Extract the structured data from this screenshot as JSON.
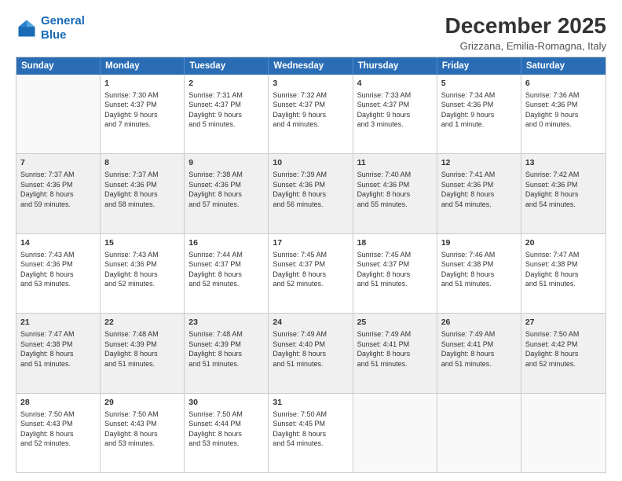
{
  "logo": {
    "line1": "General",
    "line2": "Blue"
  },
  "title": "December 2025",
  "subtitle": "Grizzana, Emilia-Romagna, Italy",
  "weekdays": [
    "Sunday",
    "Monday",
    "Tuesday",
    "Wednesday",
    "Thursday",
    "Friday",
    "Saturday"
  ],
  "rows": [
    [
      {
        "day": "",
        "text": ""
      },
      {
        "day": "1",
        "text": "Sunrise: 7:30 AM\nSunset: 4:37 PM\nDaylight: 9 hours\nand 7 minutes."
      },
      {
        "day": "2",
        "text": "Sunrise: 7:31 AM\nSunset: 4:37 PM\nDaylight: 9 hours\nand 5 minutes."
      },
      {
        "day": "3",
        "text": "Sunrise: 7:32 AM\nSunset: 4:37 PM\nDaylight: 9 hours\nand 4 minutes."
      },
      {
        "day": "4",
        "text": "Sunrise: 7:33 AM\nSunset: 4:37 PM\nDaylight: 9 hours\nand 3 minutes."
      },
      {
        "day": "5",
        "text": "Sunrise: 7:34 AM\nSunset: 4:36 PM\nDaylight: 9 hours\nand 1 minute."
      },
      {
        "day": "6",
        "text": "Sunrise: 7:36 AM\nSunset: 4:36 PM\nDaylight: 9 hours\nand 0 minutes."
      }
    ],
    [
      {
        "day": "7",
        "text": "Sunrise: 7:37 AM\nSunset: 4:36 PM\nDaylight: 8 hours\nand 59 minutes."
      },
      {
        "day": "8",
        "text": "Sunrise: 7:37 AM\nSunset: 4:36 PM\nDaylight: 8 hours\nand 58 minutes."
      },
      {
        "day": "9",
        "text": "Sunrise: 7:38 AM\nSunset: 4:36 PM\nDaylight: 8 hours\nand 57 minutes."
      },
      {
        "day": "10",
        "text": "Sunrise: 7:39 AM\nSunset: 4:36 PM\nDaylight: 8 hours\nand 56 minutes."
      },
      {
        "day": "11",
        "text": "Sunrise: 7:40 AM\nSunset: 4:36 PM\nDaylight: 8 hours\nand 55 minutes."
      },
      {
        "day": "12",
        "text": "Sunrise: 7:41 AM\nSunset: 4:36 PM\nDaylight: 8 hours\nand 54 minutes."
      },
      {
        "day": "13",
        "text": "Sunrise: 7:42 AM\nSunset: 4:36 PM\nDaylight: 8 hours\nand 54 minutes."
      }
    ],
    [
      {
        "day": "14",
        "text": "Sunrise: 7:43 AM\nSunset: 4:36 PM\nDaylight: 8 hours\nand 53 minutes."
      },
      {
        "day": "15",
        "text": "Sunrise: 7:43 AM\nSunset: 4:36 PM\nDaylight: 8 hours\nand 52 minutes."
      },
      {
        "day": "16",
        "text": "Sunrise: 7:44 AM\nSunset: 4:37 PM\nDaylight: 8 hours\nand 52 minutes."
      },
      {
        "day": "17",
        "text": "Sunrise: 7:45 AM\nSunset: 4:37 PM\nDaylight: 8 hours\nand 52 minutes."
      },
      {
        "day": "18",
        "text": "Sunrise: 7:45 AM\nSunset: 4:37 PM\nDaylight: 8 hours\nand 51 minutes."
      },
      {
        "day": "19",
        "text": "Sunrise: 7:46 AM\nSunset: 4:38 PM\nDaylight: 8 hours\nand 51 minutes."
      },
      {
        "day": "20",
        "text": "Sunrise: 7:47 AM\nSunset: 4:38 PM\nDaylight: 8 hours\nand 51 minutes."
      }
    ],
    [
      {
        "day": "21",
        "text": "Sunrise: 7:47 AM\nSunset: 4:38 PM\nDaylight: 8 hours\nand 51 minutes."
      },
      {
        "day": "22",
        "text": "Sunrise: 7:48 AM\nSunset: 4:39 PM\nDaylight: 8 hours\nand 51 minutes."
      },
      {
        "day": "23",
        "text": "Sunrise: 7:48 AM\nSunset: 4:39 PM\nDaylight: 8 hours\nand 51 minutes."
      },
      {
        "day": "24",
        "text": "Sunrise: 7:49 AM\nSunset: 4:40 PM\nDaylight: 8 hours\nand 51 minutes."
      },
      {
        "day": "25",
        "text": "Sunrise: 7:49 AM\nSunset: 4:41 PM\nDaylight: 8 hours\nand 51 minutes."
      },
      {
        "day": "26",
        "text": "Sunrise: 7:49 AM\nSunset: 4:41 PM\nDaylight: 8 hours\nand 51 minutes."
      },
      {
        "day": "27",
        "text": "Sunrise: 7:50 AM\nSunset: 4:42 PM\nDaylight: 8 hours\nand 52 minutes."
      }
    ],
    [
      {
        "day": "28",
        "text": "Sunrise: 7:50 AM\nSunset: 4:43 PM\nDaylight: 8 hours\nand 52 minutes."
      },
      {
        "day": "29",
        "text": "Sunrise: 7:50 AM\nSunset: 4:43 PM\nDaylight: 8 hours\nand 53 minutes."
      },
      {
        "day": "30",
        "text": "Sunrise: 7:50 AM\nSunset: 4:44 PM\nDaylight: 8 hours\nand 53 minutes."
      },
      {
        "day": "31",
        "text": "Sunrise: 7:50 AM\nSunset: 4:45 PM\nDaylight: 8 hours\nand 54 minutes."
      },
      {
        "day": "",
        "text": ""
      },
      {
        "day": "",
        "text": ""
      },
      {
        "day": "",
        "text": ""
      }
    ]
  ]
}
